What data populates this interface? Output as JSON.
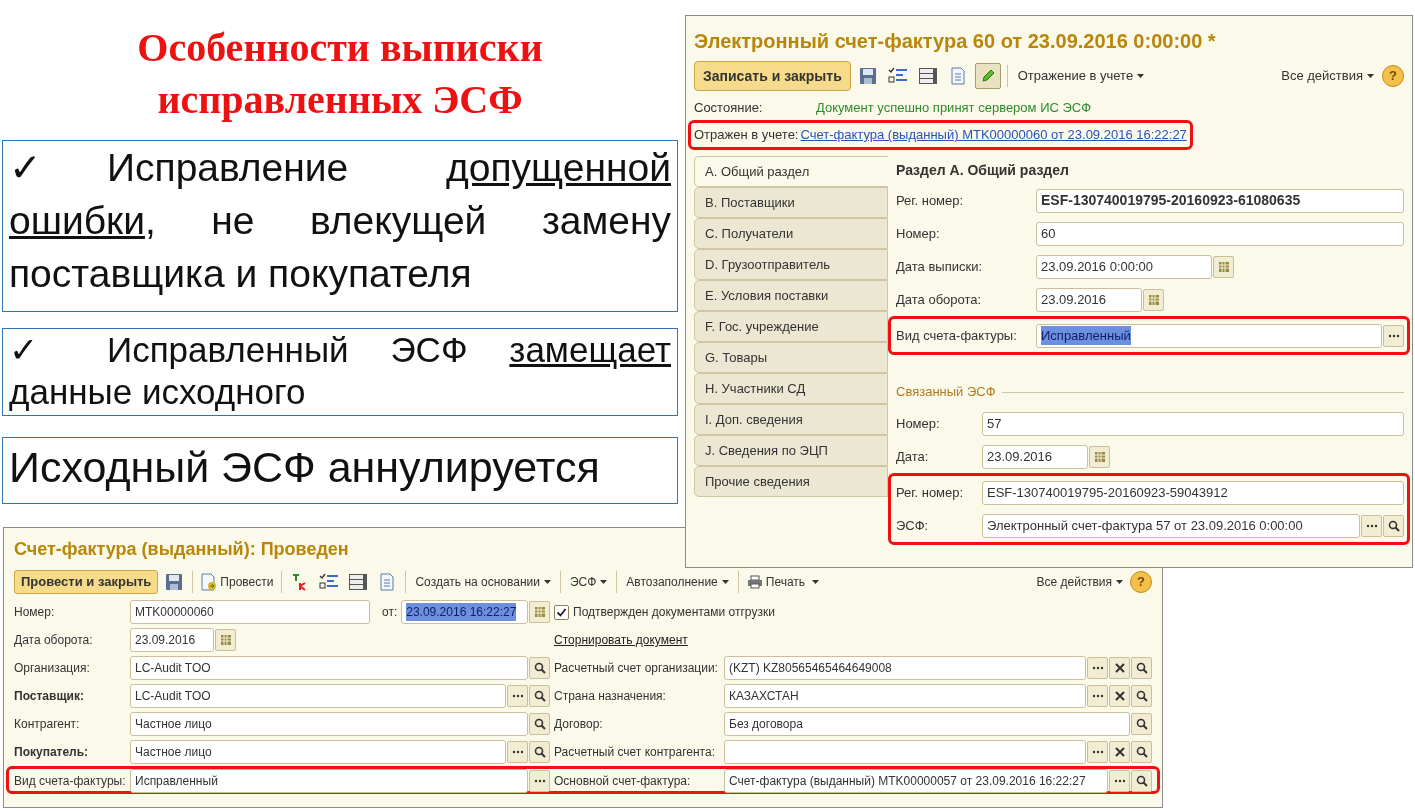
{
  "slide_title": "Особенности выписки исправленных ЭСФ",
  "bullets": [
    {
      "kind": "check",
      "marker": "✓",
      "segments": [
        {
          "text": "Исправление ",
          "underline": false
        },
        {
          "text": "допущенной ошибки",
          "underline": true
        },
        {
          "text": ", не влекущей замену поставщика и покупателя",
          "underline": false
        }
      ]
    },
    {
      "kind": "check",
      "marker": "✓",
      "segments": [
        {
          "text": "Исправленный ЭСФ ",
          "underline": false
        },
        {
          "text": "замещает",
          "underline": true
        },
        {
          "text": " данные исходного",
          "underline": false
        }
      ]
    },
    {
      "kind": "plain",
      "segments": [
        {
          "text": "Исходный ЭСФ аннулируется",
          "underline": false
        }
      ]
    }
  ],
  "esf_window": {
    "title": "Электронный счет-фактура 60 от 23.09.2016 0:00:00 *",
    "toolbar": {
      "primary_button": "Записать и закрыть",
      "menu": "Отражение в учете",
      "all_actions": "Все действия",
      "help": "?"
    },
    "status": {
      "label": "Состояние:",
      "value": "Документ успешно принят сервером ИС ЭСФ"
    },
    "reflected": {
      "label": "Отражен в учете:",
      "link": "Счет-фактура (выданный) MTK00000060 от 23.09.2016 16:22:27",
      "highlighted": true
    },
    "tabs": [
      {
        "label": "A. Общий раздел",
        "selected": true
      },
      {
        "label": "B. Поставщики",
        "selected": false
      },
      {
        "label": "C. Получатели",
        "selected": false
      },
      {
        "label": "D. Грузоотправитель",
        "selected": false
      },
      {
        "label": "E. Условия поставки",
        "selected": false
      },
      {
        "label": "F. Гос. учреждение",
        "selected": false
      },
      {
        "label": "G. Товары",
        "selected": false
      },
      {
        "label": "H. Участники СД",
        "selected": false
      },
      {
        "label": "I. Доп. сведения",
        "selected": false
      },
      {
        "label": "J. Сведения по ЭЦП",
        "selected": false
      },
      {
        "label": "Прочие сведения",
        "selected": false
      }
    ],
    "section_title": "Раздел А. Общий раздел",
    "fields": [
      {
        "label": "Рег. номер:",
        "value": "ESF-130740019795-20160923-61080635",
        "kind": "text",
        "bold": true
      },
      {
        "label": "Номер:",
        "value": "60",
        "kind": "text"
      },
      {
        "label": "Дата выписки:",
        "value": "23.09.2016  0:00:00",
        "kind": "date",
        "calendar": true
      },
      {
        "label": "Дата оборота:",
        "value": "23.09.2016",
        "kind": "short_date",
        "calendar": true
      },
      {
        "label": "Вид счета-фактуры:",
        "value": "Исправленный",
        "kind": "text",
        "selected": true,
        "choice": true,
        "highlighted": true
      }
    ],
    "related": {
      "title": "Связанный ЭСФ",
      "fields": [
        {
          "label": "Номер:",
          "value": "57",
          "kind": "text"
        },
        {
          "label": "Дата:",
          "value": "23.09.2016",
          "kind": "short_date",
          "calendar": true
        },
        {
          "label": "Рег. номер:",
          "value": "ESF-130740019795-20160923-59043912",
          "kind": "text",
          "highlighted": true
        },
        {
          "label": "ЭСФ:",
          "value": "Электронный счет-фактура 57 от 23.09.2016 0:00:00",
          "kind": "text",
          "choice": true,
          "search": true,
          "highlighted": true
        }
      ]
    }
  },
  "invoice_window": {
    "title": "Счет-фактура (выданный): Проведен",
    "toolbar": {
      "primary_button": "Провести и закрыть",
      "post": "Провести",
      "menus": [
        "Создать на основании",
        "ЭСФ",
        "Автозаполнение"
      ],
      "print": "Печать",
      "all_actions": "Все действия",
      "help": "?"
    },
    "rows": [
      {
        "highlighted": false,
        "left": {
          "label": "Номер:",
          "value": "MTK00000060",
          "kind": "number",
          "extra": {
            "label": "от:",
            "value": "23.09.2016 16:22:27",
            "selected": true,
            "calendar": true
          }
        },
        "right": {
          "kind": "checkbox",
          "label": "Подтвержден документами отгрузки",
          "checked": true
        }
      },
      {
        "highlighted": false,
        "left": {
          "label": "Дата оборота:",
          "value": "23.09.2016",
          "kind": "short_date",
          "calendar": true
        },
        "right": {
          "kind": "link",
          "label": "Сторнировать документ"
        }
      },
      {
        "highlighted": false,
        "left": {
          "label": "Организация:",
          "value": "LC-Audit TOO",
          "kind": "text",
          "search": true
        },
        "right": {
          "kind": "field",
          "label": "Расчетный счет организации:",
          "value": "(KZT) KZ80565465464649008",
          "choice": true,
          "clear": true,
          "search": true
        }
      },
      {
        "highlighted": false,
        "left": {
          "label": "Поставщик:",
          "bold": true,
          "value": "LC-Audit TOO",
          "kind": "text",
          "choice": true,
          "search": true
        },
        "right": {
          "kind": "field",
          "label": "Страна назначения:",
          "value": "КАЗАХСТАН",
          "choice": true,
          "clear": true,
          "search": true
        }
      },
      {
        "highlighted": false,
        "left": {
          "label": "Контрагент:",
          "value": "Частное лицо",
          "kind": "text",
          "search": true
        },
        "right": {
          "kind": "field",
          "label": "Договор:",
          "value": "Без договора",
          "search": true
        }
      },
      {
        "highlighted": false,
        "left": {
          "label": "Покупатель:",
          "bold": true,
          "value": "Частное лицо",
          "kind": "text",
          "choice": true,
          "search": true
        },
        "right": {
          "kind": "field",
          "label": "Расчетный счет контрагента:",
          "choice": true,
          "clear": true,
          "search": true
        }
      },
      {
        "highlighted": true,
        "left": {
          "label": "Вид счета-фактуры:",
          "value": "Исправленный",
          "kind": "text",
          "choice": true
        },
        "right": {
          "kind": "field",
          "label": "Основной счет-фактура:",
          "value": "Счет-фактура (выданный) MTK00000057 от 23.09.2016 16:22:27",
          "choice": true,
          "search": true
        }
      }
    ]
  }
}
